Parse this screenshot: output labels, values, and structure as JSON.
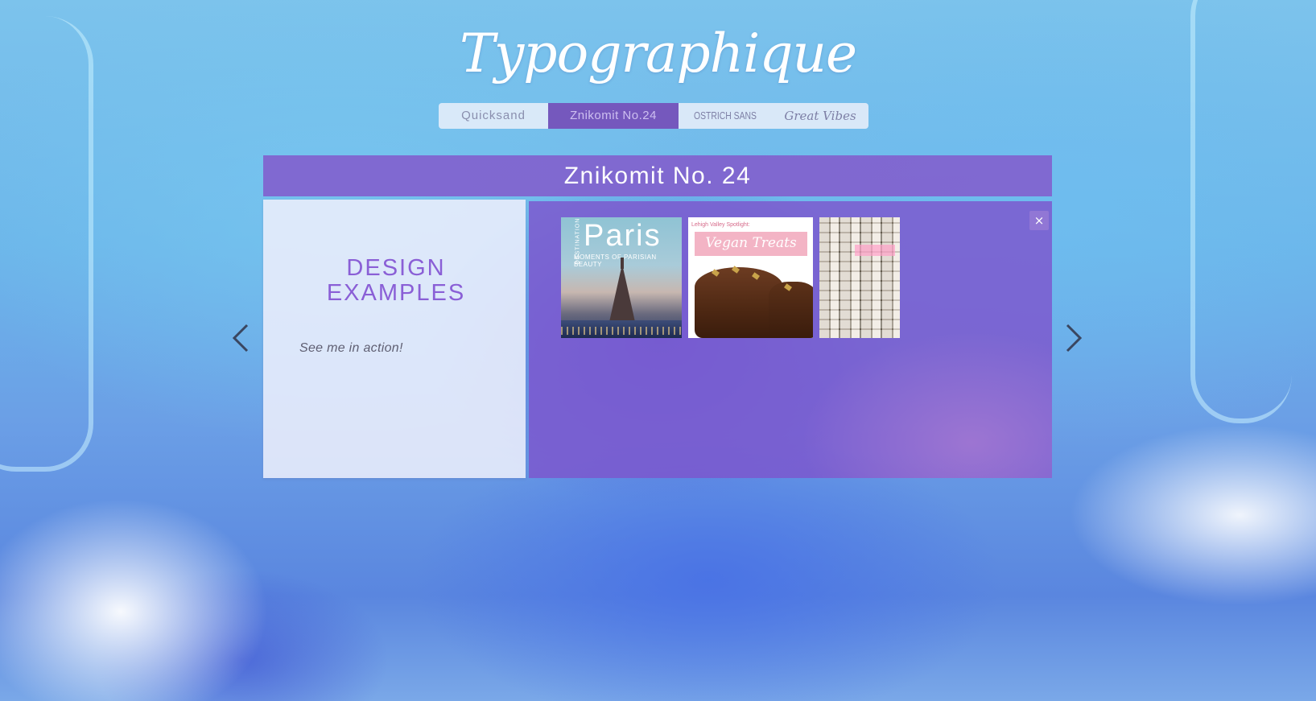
{
  "site": {
    "logo": "Typographique"
  },
  "nav": {
    "items": [
      {
        "label": "Quicksand"
      },
      {
        "label": "Znikomit No.24"
      },
      {
        "label": "OSTRICH SANS"
      },
      {
        "label": "Great Vibes"
      }
    ],
    "active": "Znikomit No.24"
  },
  "slide": {
    "title": "Znikomit No. 24",
    "heading_line1": "DESIGN",
    "heading_line2": "EXAMPLES",
    "tagline": "See me in action!",
    "close_label": "×"
  },
  "gallery": {
    "thumbs": [
      {
        "name": "paris",
        "title": "Paris",
        "subtitle": "MOMENTS OF PARISIAN BEAUTY",
        "side_text": "DESTINATION"
      },
      {
        "name": "vegan",
        "small": "Lehigh Valley Spotlight:",
        "title": "Vegan Treats"
      },
      {
        "name": "stack",
        "title": ""
      }
    ]
  },
  "icons": {
    "prev": "chevron-left-icon",
    "next": "chevron-right-icon",
    "close": "close-icon"
  },
  "colors": {
    "accent": "#7558bd",
    "title_bar": "#825fcd",
    "heading": "#8a5fd6"
  }
}
